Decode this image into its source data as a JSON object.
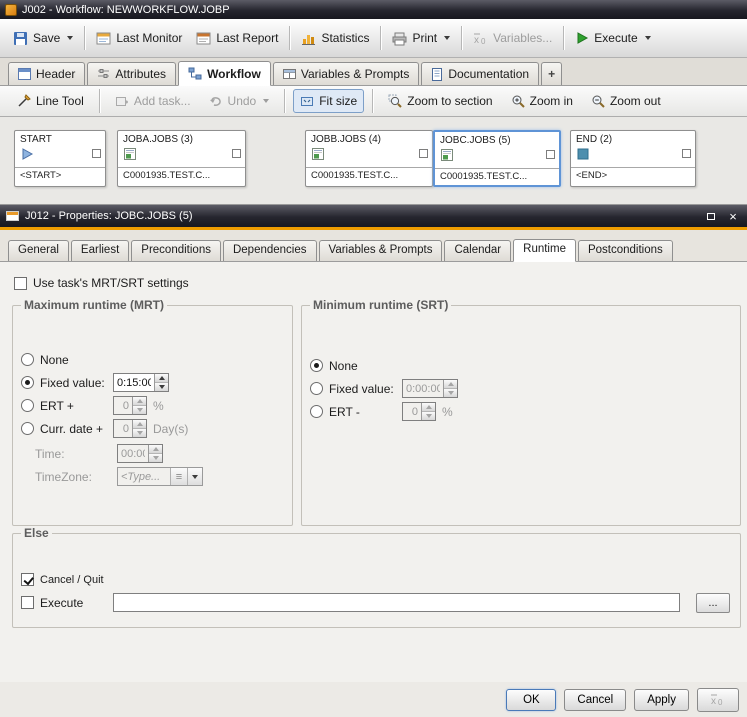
{
  "window": {
    "title": "J002 - Workflow: NEWWORKFLOW.JOBP"
  },
  "toolbar": {
    "save": "Save",
    "last_monitor": "Last Monitor",
    "last_report": "Last Report",
    "statistics": "Statistics",
    "print": "Print",
    "variables": "Variables...",
    "execute": "Execute"
  },
  "main_tabs": {
    "header": "Header",
    "attributes": "Attributes",
    "workflow": "Workflow",
    "variables_prompts": "Variables & Prompts",
    "documentation": "Documentation",
    "add": "+"
  },
  "workflow_toolbar": {
    "line_tool": "Line Tool",
    "add_task": "Add task...",
    "undo": "Undo",
    "fit_size": "Fit size",
    "zoom_to_section": "Zoom to section",
    "zoom_in": "Zoom in",
    "zoom_out": "Zoom out"
  },
  "canvas": {
    "nodes": [
      {
        "title": "START",
        "subtitle": "<START>"
      },
      {
        "title": "JOBA.JOBS (3)",
        "subtitle": "C0001935.TEST.C..."
      },
      {
        "title": "JOBB.JOBS (4)",
        "subtitle": "C0001935.TEST.C..."
      },
      {
        "title": "JOBC.JOBS (5)",
        "subtitle": "C0001935.TEST.C..."
      },
      {
        "title": "END (2)",
        "subtitle": "<END>"
      }
    ]
  },
  "properties": {
    "title": "J012 - Properties: JOBC.JOBS (5)",
    "tabs": {
      "general": "General",
      "earliest": "Earliest",
      "preconditions": "Preconditions",
      "dependencies": "Dependencies",
      "variables_prompts": "Variables & Prompts",
      "calendar": "Calendar",
      "runtime": "Runtime",
      "postconditions": "Postconditions"
    },
    "runtime": {
      "use_mrt_srt_label": "Use task's MRT/SRT settings",
      "mrt": {
        "title": "Maximum runtime (MRT)",
        "none_label": "None",
        "fixed_value_label": "Fixed value:",
        "fixed_value": "0:15:00",
        "ert_label": "ERT +",
        "ert_value": "0",
        "ert_unit": "%",
        "curr_date_label": "Curr. date +",
        "curr_date_value": "0",
        "curr_date_unit": "Day(s)",
        "time_label": "Time:",
        "time_value": "00:00",
        "timezone_label": "TimeZone:",
        "timezone_placeholder": "<Type..."
      },
      "srt": {
        "title": "Minimum runtime (SRT)",
        "none_label": "None",
        "fixed_value_label": "Fixed value:",
        "fixed_value": "0:00:00",
        "ert_label": "ERT -",
        "ert_value": "0",
        "ert_unit": "%"
      },
      "else": {
        "title": "Else",
        "cancel_quit_label": "Cancel / Quit",
        "execute_label": "Execute",
        "execute_value": "",
        "browse_label": "..."
      }
    },
    "buttons": {
      "ok": "OK",
      "cancel": "Cancel",
      "apply": "Apply"
    }
  }
}
